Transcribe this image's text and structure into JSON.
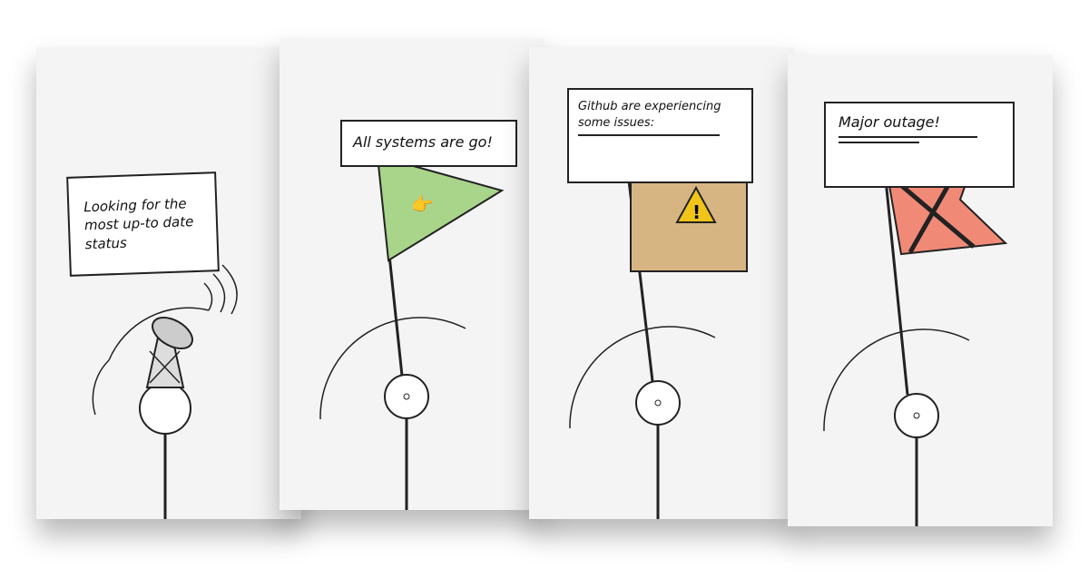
{
  "panels": [
    {
      "message": "Looking for the most up-to date status",
      "state": "checking",
      "icon": "satellite-dish-icon"
    },
    {
      "message": "All systems are go!",
      "state": "ok",
      "icon": "thumbs-up-icon",
      "flag_color": "#a9d58a"
    },
    {
      "message": "Github are experiencing some issues:",
      "state": "warning",
      "icon": "warning-icon",
      "flag_color": "#d7b583"
    },
    {
      "message": "Major outage!",
      "state": "outage",
      "icon": "x-mark-icon",
      "flag_color": "#f08a77"
    }
  ]
}
